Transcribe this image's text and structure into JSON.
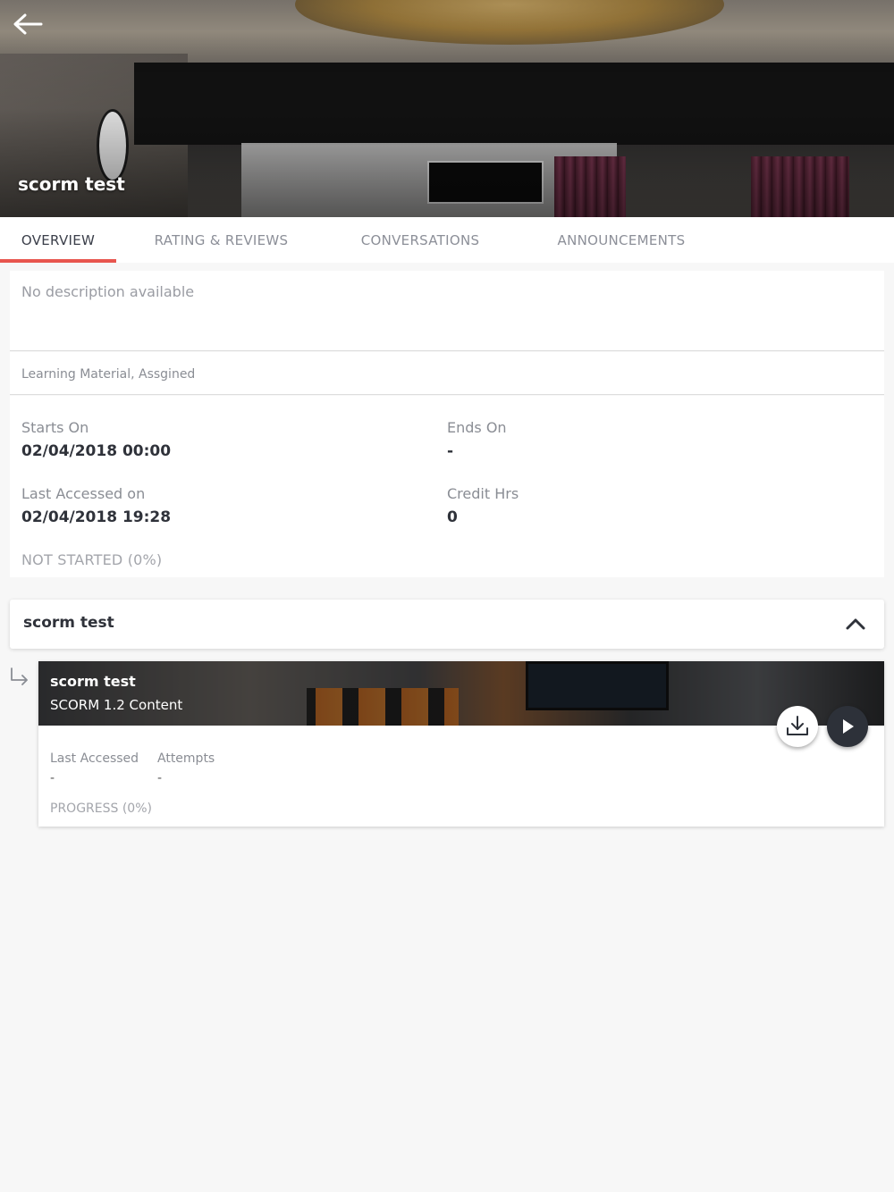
{
  "hero": {
    "title": "scorm test"
  },
  "tabs": [
    {
      "label": "OVERVIEW",
      "active": true
    },
    {
      "label": "RATING & REVIEWS",
      "active": false
    },
    {
      "label": "CONVERSATIONS",
      "active": false
    },
    {
      "label": "ANNOUNCEMENTS",
      "active": false
    }
  ],
  "overview": {
    "description": "No description available",
    "type": "Learning Material, Assgined",
    "starts_on": {
      "label": "Starts On",
      "value": "02/04/2018 00:00"
    },
    "ends_on": {
      "label": "Ends On",
      "value": "-"
    },
    "last_accessed": {
      "label": "Last Accessed on",
      "value": "02/04/2018 19:28"
    },
    "credit_hrs": {
      "label": "Credit Hrs",
      "value": "0"
    },
    "status": "NOT STARTED (0%)"
  },
  "module": {
    "title": "scorm test",
    "item": {
      "title": "scorm test",
      "subtitle": "SCORM 1.2 Content",
      "last_accessed": {
        "label": "Last Accessed",
        "value": "-"
      },
      "attempts": {
        "label": "Attempts",
        "value": "-"
      },
      "progress": "PROGRESS (0%)"
    }
  },
  "colors": {
    "accent": "#e8554e",
    "play_button": "#2d3139"
  },
  "icons": [
    "back-arrow-icon",
    "chevron-up-icon",
    "sub-item-arrow-icon",
    "download-icon",
    "play-icon"
  ]
}
